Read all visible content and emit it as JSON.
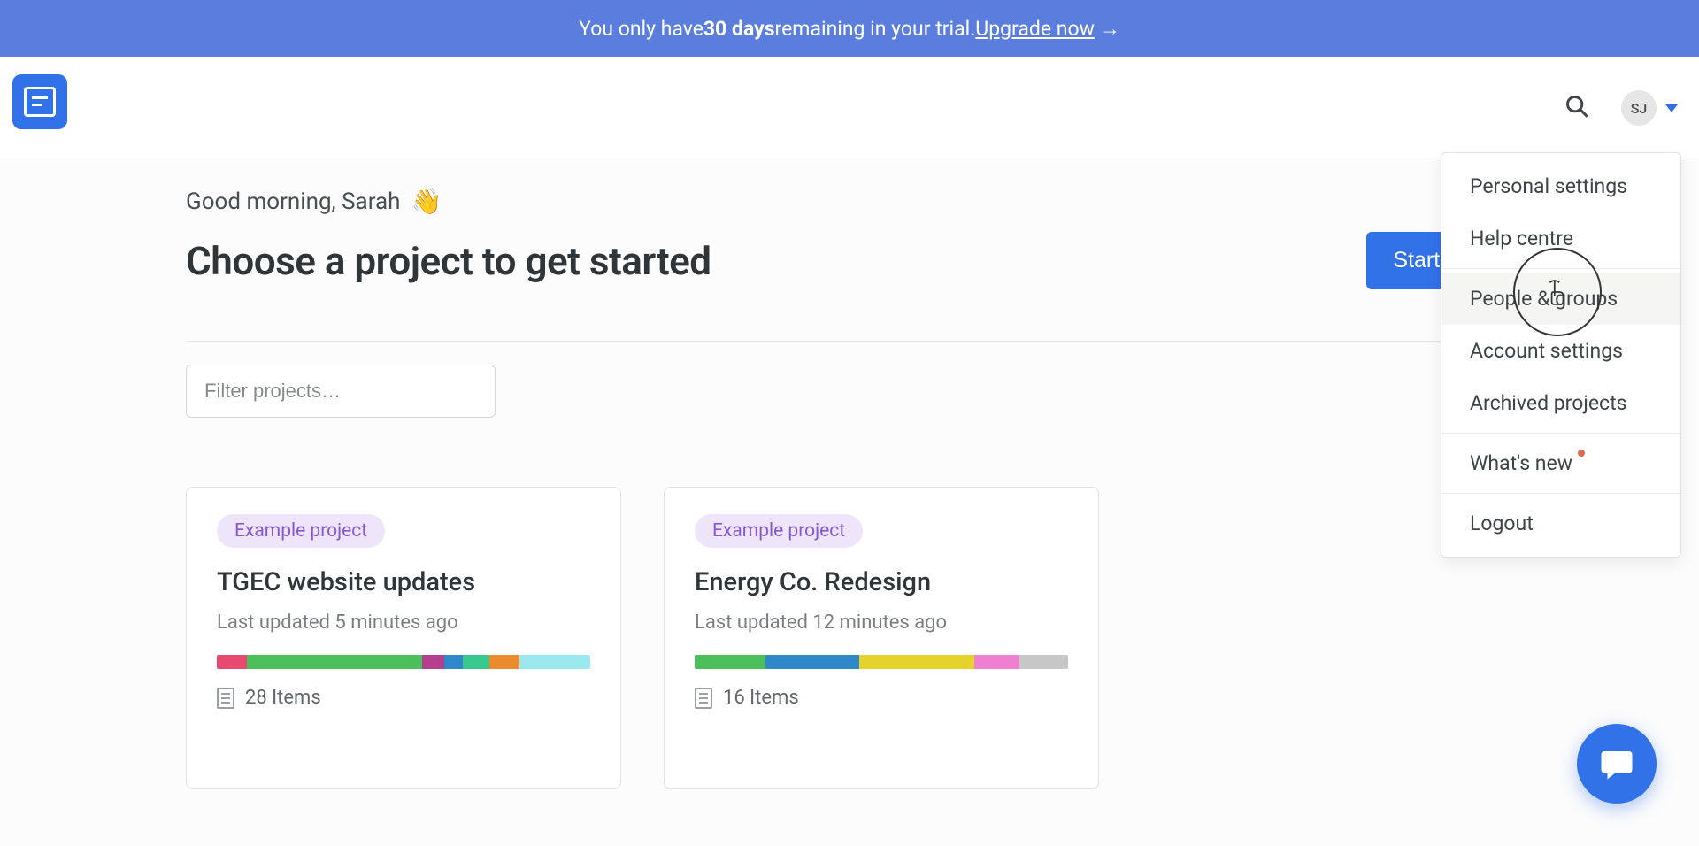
{
  "banner": {
    "prefix": "You only have ",
    "bold": "30 days",
    "middle": " remaining in your trial. ",
    "cta": "Upgrade now",
    "arrow": "→"
  },
  "topbar": {
    "avatar_initials": "SJ"
  },
  "greeting": {
    "text": "Good morning, Sarah",
    "emoji": "👋"
  },
  "page": {
    "title": "Choose a project to get started",
    "start_button": "Start new",
    "filter_placeholder": "Filter projects…"
  },
  "projects": [
    {
      "tag": "Example project",
      "title": "TGEC website updates",
      "subtitle": "Last updated 5 minutes ago",
      "items_label": "28 Items",
      "segments": [
        {
          "color": "#e84a6f",
          "pct": 8
        },
        {
          "color": "#4bbf5a",
          "pct": 47
        },
        {
          "color": "#b43f8e",
          "pct": 6
        },
        {
          "color": "#2f88c9",
          "pct": 5
        },
        {
          "color": "#38c78c",
          "pct": 7
        },
        {
          "color": "#ea8b2e",
          "pct": 8
        },
        {
          "color": "#9be8ef",
          "pct": 19
        }
      ]
    },
    {
      "tag": "Example project",
      "title": "Energy Co. Redesign",
      "subtitle": "Last updated 12 minutes ago",
      "items_label": "16 Items",
      "segments": [
        {
          "color": "#4bbf5a",
          "pct": 19
        },
        {
          "color": "#2f88c9",
          "pct": 25
        },
        {
          "color": "#e6d22c",
          "pct": 31
        },
        {
          "color": "#ef7fd0",
          "pct": 12
        },
        {
          "color": "#c7c7c7",
          "pct": 13
        }
      ]
    }
  ],
  "dropdown": {
    "items": [
      {
        "label": "Personal settings",
        "sep_after": false,
        "hover": false,
        "dot": false
      },
      {
        "label": "Help centre",
        "sep_after": true,
        "hover": false,
        "dot": false
      },
      {
        "label": "People & groups",
        "sep_after": false,
        "hover": true,
        "dot": false
      },
      {
        "label": "Account settings",
        "sep_after": false,
        "hover": false,
        "dot": false
      },
      {
        "label": "Archived projects",
        "sep_after": true,
        "hover": false,
        "dot": false
      },
      {
        "label": "What's new",
        "sep_after": true,
        "hover": false,
        "dot": true
      },
      {
        "label": "Logout",
        "sep_after": false,
        "hover": false,
        "dot": false
      }
    ]
  }
}
